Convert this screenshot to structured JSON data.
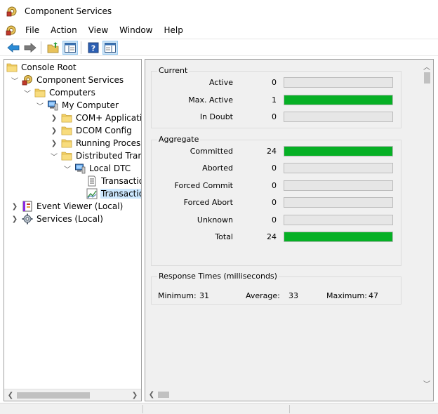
{
  "window": {
    "title": "Component Services"
  },
  "menu": [
    "File",
    "Action",
    "View",
    "Window",
    "Help"
  ],
  "tree": [
    {
      "label": "Console Root",
      "icon": "folder-icon",
      "level": 0,
      "expander": ""
    },
    {
      "label": "Component Services",
      "icon": "component-services-icon",
      "level": 1,
      "expander": "expanded"
    },
    {
      "label": "Computers",
      "icon": "folder-icon",
      "level": 2,
      "expander": "expanded"
    },
    {
      "label": "My Computer",
      "icon": "computer-icon",
      "level": 3,
      "expander": "expanded"
    },
    {
      "label": "COM+ Applications",
      "icon": "folder-icon",
      "level": 4,
      "expander": "collapsed"
    },
    {
      "label": "DCOM Config",
      "icon": "folder-icon",
      "level": 4,
      "expander": "collapsed"
    },
    {
      "label": "Running Processes",
      "icon": "folder-icon",
      "level": 4,
      "expander": "collapsed"
    },
    {
      "label": "Distributed Transaction Coordinator",
      "icon": "folder-icon",
      "level": 4,
      "expander": "expanded"
    },
    {
      "label": "Local DTC",
      "icon": "computer-icon",
      "level": 5,
      "expander": "expanded"
    },
    {
      "label": "Transaction List",
      "icon": "list-document-icon",
      "level": 6,
      "expander": ""
    },
    {
      "label": "Transaction Statistics",
      "icon": "chart-icon",
      "level": 6,
      "expander": "",
      "selected": true
    },
    {
      "label": "Event Viewer (Local)",
      "icon": "event-viewer-icon",
      "level": 1,
      "expander": "collapsed"
    },
    {
      "label": "Services (Local)",
      "icon": "gear-icon",
      "level": 1,
      "expander": "collapsed"
    }
  ],
  "stats": {
    "current": {
      "title": "Current",
      "rows": [
        {
          "label": "Active",
          "value": "0",
          "fill": 0
        },
        {
          "label": "Max. Active",
          "value": "1",
          "fill": 1
        },
        {
          "label": "In Doubt",
          "value": "0",
          "fill": 0
        }
      ]
    },
    "aggregate": {
      "title": "Aggregate",
      "rows": [
        {
          "label": "Committed",
          "value": "24",
          "fill": 1
        },
        {
          "label": "Aborted",
          "value": "0",
          "fill": 0
        },
        {
          "label": "Forced Commit",
          "value": "0",
          "fill": 0
        },
        {
          "label": "Forced Abort",
          "value": "0",
          "fill": 0
        },
        {
          "label": "Unknown",
          "value": "0",
          "fill": 0
        },
        {
          "label": "Total",
          "value": "24",
          "fill": 1
        }
      ]
    },
    "response": {
      "title": "Response Times (milliseconds)",
      "minimum_label": "Minimum:",
      "minimum": "31",
      "average_label": "Average:",
      "average": "33",
      "maximum_label": "Maximum:",
      "maximum": "47"
    }
  },
  "colors": {
    "bar_fill": "#06b025",
    "bar_empty": "#e6e6e6",
    "pane_bg": "#f0f0f0",
    "selection": "#cce8ff"
  }
}
